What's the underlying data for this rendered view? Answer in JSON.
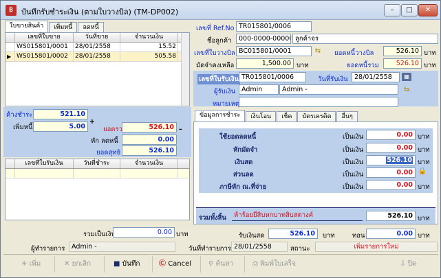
{
  "window": {
    "title": "บันทึกรับชำระเงิน (ตามใบวางบิล) (TM-DP002)",
    "min": "–",
    "max": "□",
    "close": "✕"
  },
  "left_tabs": [
    "ใบขายสินค้า",
    "เพิ่มหนี้",
    "ลดหนี้"
  ],
  "sales_grid": {
    "headers": [
      "เลขที่ใบขาย",
      "วันที่ขาย",
      "จำนวนเงิน"
    ],
    "rows": [
      {
        "marker": "",
        "no": "WS015801/0001",
        "date": "28/01/2558",
        "amount": "15.52"
      },
      {
        "marker": "▶",
        "no": "WS015801/0002",
        "date": "28/01/2558",
        "amount": "505.58"
      }
    ]
  },
  "left_summary": {
    "due_label": "ค้างชำระ",
    "due": "521.10",
    "add_label": "เพิ่มหนี้",
    "add": "5.00",
    "plus": "+",
    "total_label": "ยอดรวม",
    "total": "526.10",
    "minus": "–",
    "reduce_label": "หัก ลดหนี้",
    "reduce": "0.00",
    "net_label": "ยอดสุทธิ",
    "net": "526.10"
  },
  "receipt_grid": {
    "headers": [
      "เลขที่ใบรับเงิน",
      "วันที่ชำระ",
      "จำนวนเงิน"
    ]
  },
  "total_money": {
    "label": "รวมเป็นเงิน",
    "value": "0.00",
    "unit": "บาท"
  },
  "header": {
    "ref_label": "เลขที่ Ref.No :",
    "ref": "TR015801/0006",
    "cust_label": "ชื่อลูกค้า",
    "cust_code": "000-0000-00000",
    "cust_name": "ลูกค้าจร",
    "bill_label": "เลขที่ใบวางบิล",
    "bill": "BC015801/0001",
    "bill_total_label": "ยอดหนี้วางบิล",
    "bill_total": "526.10",
    "unit": "บาท",
    "deposit_label": "มัดจำคงเหลือ",
    "deposit": "1,500.00",
    "deposit_unit": "บาท",
    "grand_label": "ยอดหนี้รวม",
    "grand": "526.10",
    "grand_unit": "บาท"
  },
  "receipt": {
    "no_label": "เลขที่ใบรับเงิน",
    "no": "TR015801/0006",
    "date_label": "วันที่รับเงิน",
    "date": "28/01/2558",
    "recv_label": "ผู้รับเงิน",
    "recv_code": "Admin",
    "recv_name": "Admin -",
    "note_label": "หมายเหตุ",
    "note": ""
  },
  "pay_tabs": [
    "ข้อมูลการชำระ",
    "เงินโอน",
    "เช็ค",
    "บัตรเครดิต",
    "อื่นๆ"
  ],
  "pay_rows": [
    {
      "label": "ใช้ยอดลดหนี้",
      "as": "เป็นเงิน",
      "value": "0.00",
      "unit": "บาท"
    },
    {
      "label": "หักมัดจำ",
      "as": "เป็นเงิน",
      "value": "0.00",
      "unit": "บาท"
    },
    {
      "label": "เงินสด",
      "as": "เป็นเงิน",
      "value": "526.10",
      "unit": "บาท"
    },
    {
      "label": "ส่วนลด",
      "as": "เป็นเงิน",
      "value": "0.00",
      "unit": "บาท"
    },
    {
      "label": "ภาษีหัก ณ.ที่จ่าย",
      "as": "เป็นเงิน",
      "value": "0.00",
      "unit": "บาท"
    }
  ],
  "grand_total": {
    "label": "รวมทั้งสิ้น",
    "text": "ห้าร้อยยี่สิบหกบาทสิบสตางค์",
    "value": "526.10",
    "unit": "บาท"
  },
  "received": {
    "label": "รับเงินสด",
    "value": "526.10",
    "unit": "บาท",
    "change_label": "ทอน",
    "change": "0.00",
    "change_unit": "บาท"
  },
  "footer": {
    "op_label": "ผู้ทำรายการ",
    "op": "Admin -",
    "date_label": "วันที่ทำรายการ",
    "date": "28/01/2558",
    "status_label": "สถานะ",
    "status": "เพิ่มรายการใหม่"
  },
  "toolbar": {
    "add": "เพิ่ม",
    "cancel_doc": "ยกเลิก",
    "save": "บันทึก",
    "cancel": "Cancel",
    "search": "ค้นหา",
    "print": "พิมพ์ใบเสร็จ",
    "close": "ปิด"
  }
}
